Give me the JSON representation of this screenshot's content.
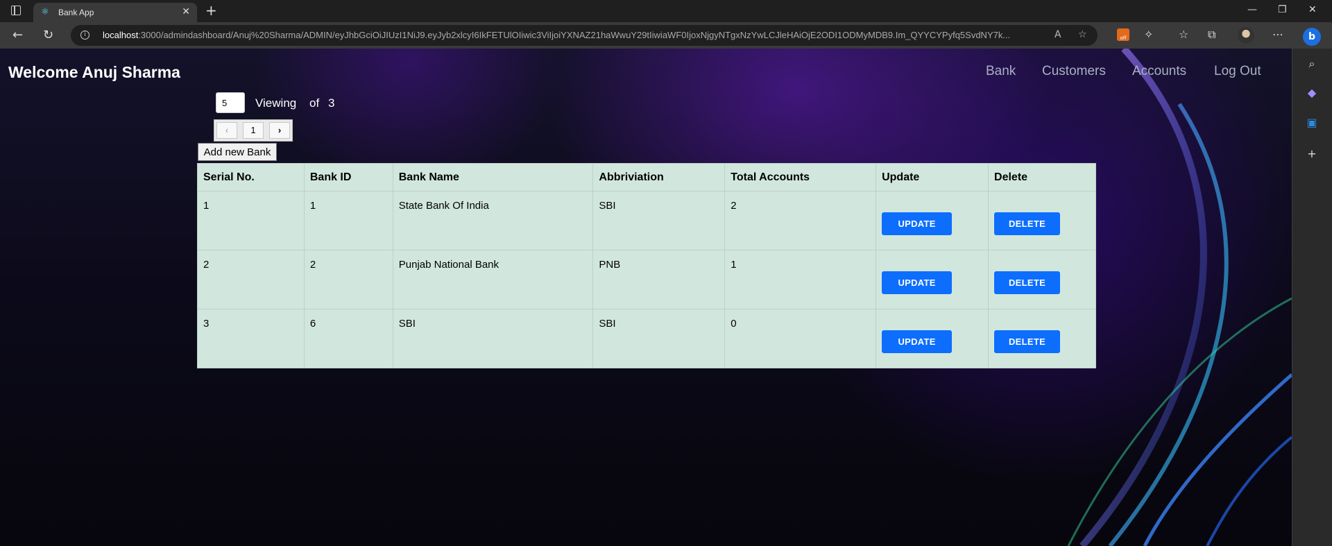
{
  "browser": {
    "tab_title": "Bank App",
    "url_host": "localhost",
    "url_rest": ":3000/admindashboard/Anuj%20Sharma/ADMIN/eyJhbGciOiJIUzI1NiJ9.eyJyb2xlcyI6IkFETUlOIiwic3ViIjoiYXNAZ21haWwuY29tIiwiaWF0IjoxNjgyNTgxNzYwLCJleHAiOjE2ODI1ODMyMDB9.Im_QYYCYPyfq5SvdNY7k...",
    "ext_badge": "off"
  },
  "header": {
    "welcome": "Welcome Anuj Sharma",
    "nav": [
      "Bank",
      "Customers",
      "Accounts",
      "Log Out"
    ]
  },
  "pagination": {
    "page_size": "5",
    "viewing_label": "Viewing",
    "of_label": "of",
    "total": "3",
    "current_page": "1",
    "prev": "‹",
    "next": "›"
  },
  "add_button": "Add new Bank",
  "table": {
    "headers": [
      "Serial No.",
      "Bank ID",
      "Bank Name",
      "Abbriviation",
      "Total Accounts",
      "Update",
      "Delete"
    ],
    "rows": [
      [
        "1",
        "1",
        "State Bank Of India",
        "SBI",
        "2"
      ],
      [
        "2",
        "2",
        "Punjab National Bank",
        "PNB",
        "1"
      ],
      [
        "3",
        "6",
        "SBI",
        "SBI",
        "0"
      ]
    ],
    "update_label": "UPDATE",
    "delete_label": "DELETE"
  },
  "colors": {
    "table_bg": "#d1e7dd",
    "button_primary": "#0d6efd"
  }
}
